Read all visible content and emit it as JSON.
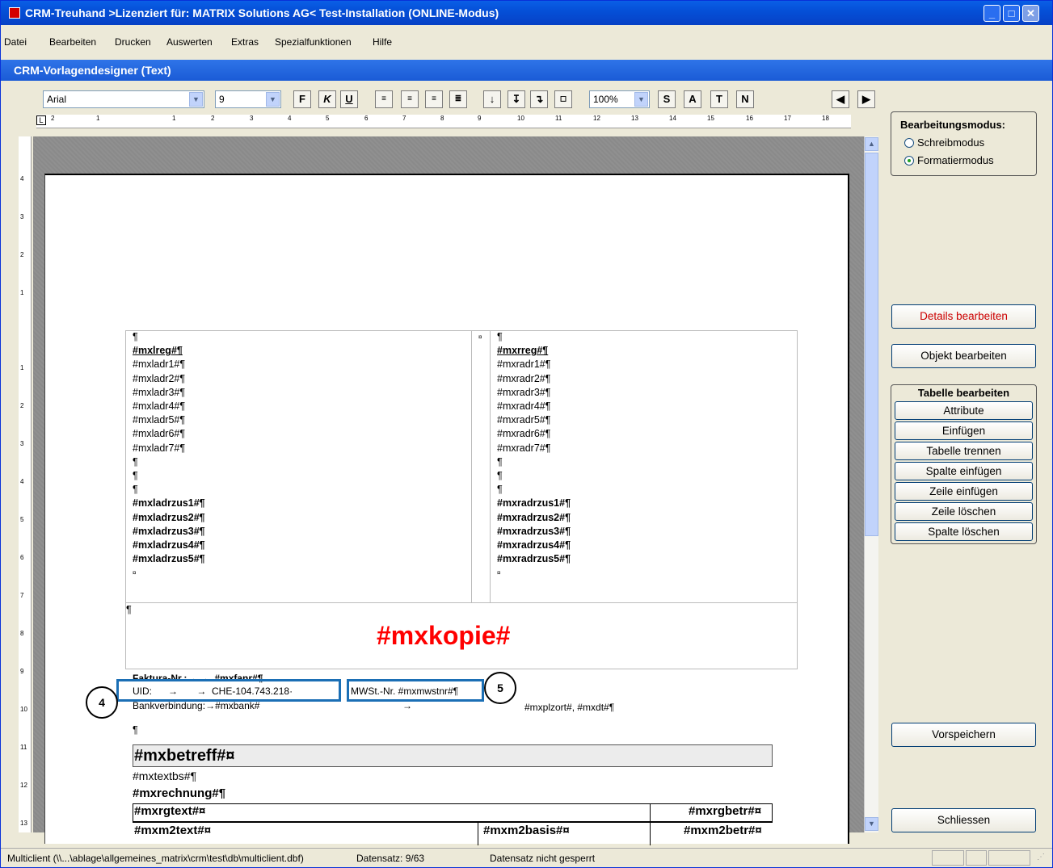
{
  "window": {
    "title": "CRM-Treuhand >Lizenziert für: MATRIX Solutions AG< Test-Installation (ONLINE-Modus)"
  },
  "menu": [
    "Datei",
    "Bearbeiten",
    "Drucken",
    "Auswerten",
    "Extras",
    "Spezialfunktionen",
    "Hilfe"
  ],
  "subtitle": "CRM-Vorlagendesigner (Text)",
  "toolbar": {
    "font": "Arial",
    "size": "9",
    "zoom": "100%",
    "bold": "F",
    "italic": "K",
    "underline": "U",
    "s": "S",
    "a": "A",
    "t": "T",
    "n": "N"
  },
  "ruler": {
    "h": [
      "2",
      "1",
      "1",
      "2",
      "3",
      "4",
      "5",
      "6",
      "7",
      "8",
      "9",
      "10",
      "11",
      "12",
      "13",
      "14",
      "15",
      "16",
      "17",
      "18"
    ],
    "v": [
      "4",
      "3",
      "2",
      "1",
      "1",
      "2",
      "3",
      "4",
      "5",
      "6",
      "7",
      "8",
      "9",
      "10",
      "11",
      "12",
      "13"
    ]
  },
  "doc": {
    "left": [
      "¶",
      "#mxlreg#¶",
      "#mxladr1#¶",
      "#mxladr2#¶",
      "#mxladr3#¶",
      "#mxladr4#¶",
      "#mxladr5#¶",
      "#mxladr6#¶",
      "#mxladr7#¶",
      "¶",
      "¶",
      "¶",
      "#mxladrzus1#¶",
      "#mxladrzus2#¶",
      "#mxladrzus3#¶",
      "#mxladrzus4#¶",
      "#mxladrzus5#¶",
      "¤"
    ],
    "right": [
      "¶",
      "#mxrreg#¶",
      "#mxradr1#¶",
      "#mxradr2#¶",
      "#mxradr3#¶",
      "#mxradr4#¶",
      "#mxradr5#¶",
      "#mxradr6#¶",
      "#mxradr7#¶",
      "¶",
      "¶",
      "¶",
      "#mxradrzus1#¶",
      "#mxradrzus2#¶",
      "#mxradrzus3#¶",
      "#mxradrzus4#¶",
      "#mxradrzus5#¶",
      "¤"
    ],
    "mid": "¤",
    "para": "¶",
    "kopie": "#mxkopie#",
    "faktura": "Faktura-Nr.:→ →  #mxfanr#¶",
    "uid": "UID:      →       →  CHE-104.743.218·",
    "mwst": "MWSt.-Nr. #mxmwstnr#¶",
    "bank": "Bankverbindung:→#mxbank#",
    "arrow": "→",
    "ort": "#mxplzort#, #mxdt#¶",
    "para2": "¶",
    "betreff": "#mxbetreff#¤",
    "textbs": "#mxtextbs#¶",
    "rechnung": "#mxrechnung#¶",
    "rgtext": "#mxrgtext#¤",
    "rgbetr": "#mxrgbetr#¤",
    "m2text": "#mxm2text#¤",
    "m2basis": "#mxm2basis#¤",
    "m2betr": "#mxm2betr#¤"
  },
  "callouts": {
    "c4": "4",
    "c5": "5"
  },
  "mode": {
    "heading": "Bearbeitungsmodus:",
    "opt1": "Schreibmodus",
    "opt2": "Formatiermodus"
  },
  "buttons": {
    "details": "Details bearbeiten",
    "objekt": "Objekt bearbeiten",
    "vorspeichern": "Vorspeichern",
    "schliessen": "Schliessen"
  },
  "tablegroup": {
    "heading": "Tabelle bearbeiten",
    "items": [
      "Attribute",
      "Einfügen",
      "Tabelle trennen",
      "Spalte einfügen",
      "Zeile einfügen",
      "Zeile löschen",
      "Spalte löschen"
    ]
  },
  "status": {
    "file": "Multiclient (\\\\...\\ablage\\allgemeines_matrix\\crm\\test\\db\\multiclient.dbf)",
    "record": "Datensatz: 9/63",
    "lock": "Datensatz nicht gesperrt"
  },
  "colors": {
    "titlebar": "#0550d8",
    "kopie": "#ff0000",
    "details": "#cc0000",
    "callout": "#1b6fb5"
  }
}
